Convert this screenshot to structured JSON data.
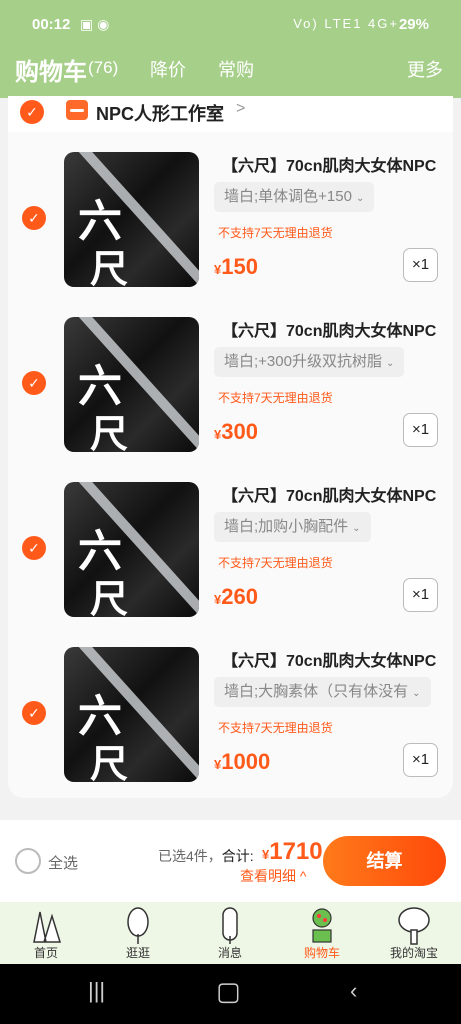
{
  "status_bar": {
    "time": "00:12",
    "signal": "Vo) LTE1 4G+",
    "battery": "29%"
  },
  "header": {
    "title": "购物车",
    "count": "(76)",
    "tabs": [
      "降价",
      "常购"
    ],
    "more": "更多"
  },
  "shop": {
    "name": "NPC人形工作室",
    "arrow": ">"
  },
  "items": [
    {
      "title": "【六尺】70cn肌肉大女体NPC",
      "sku": "墙白;单体调色+150",
      "warning": "不支持7天无理由退货",
      "currency": "¥",
      "price": "150",
      "qty": "×1"
    },
    {
      "title": "【六尺】70cn肌肉大女体NPC",
      "sku": "墙白;+300升级双抗树脂",
      "warning": "不支持7天无理由退货",
      "currency": "¥",
      "price": "300",
      "qty": "×1"
    },
    {
      "title": "【六尺】70cn肌肉大女体NPC",
      "sku": "墙白;加购小胸配件",
      "warning": "不支持7天无理由退货",
      "currency": "¥",
      "price": "260",
      "qty": "×1"
    },
    {
      "title": "【六尺】70cn肌肉大女体NPC",
      "sku": "墙白;大胸素体（只有体没有",
      "warning": "不支持7天无理由退货",
      "currency": "¥",
      "price": "1000",
      "qty": "×1"
    }
  ],
  "thumb_text": {
    "line1": "六",
    "line2": "尺"
  },
  "bottom": {
    "select_all": "全选",
    "selected": "已选4件，",
    "total_label": "合计:",
    "currency": "¥",
    "total": "1710",
    "detail": "查看明细 ^",
    "checkout": "结算"
  },
  "tabbar": [
    {
      "label": "首页",
      "icon": "home-tree-icon"
    },
    {
      "label": "逛逛",
      "icon": "explore-tree-icon"
    },
    {
      "label": "消息",
      "icon": "message-tree-icon"
    },
    {
      "label": "购物车",
      "icon": "cart-tree-icon"
    },
    {
      "label": "我的淘宝",
      "icon": "profile-tree-icon"
    }
  ],
  "colors": {
    "accent": "#ff5a1a",
    "header_bg": "#a6cf8a",
    "tabbar_bg": "#eef6e6"
  }
}
